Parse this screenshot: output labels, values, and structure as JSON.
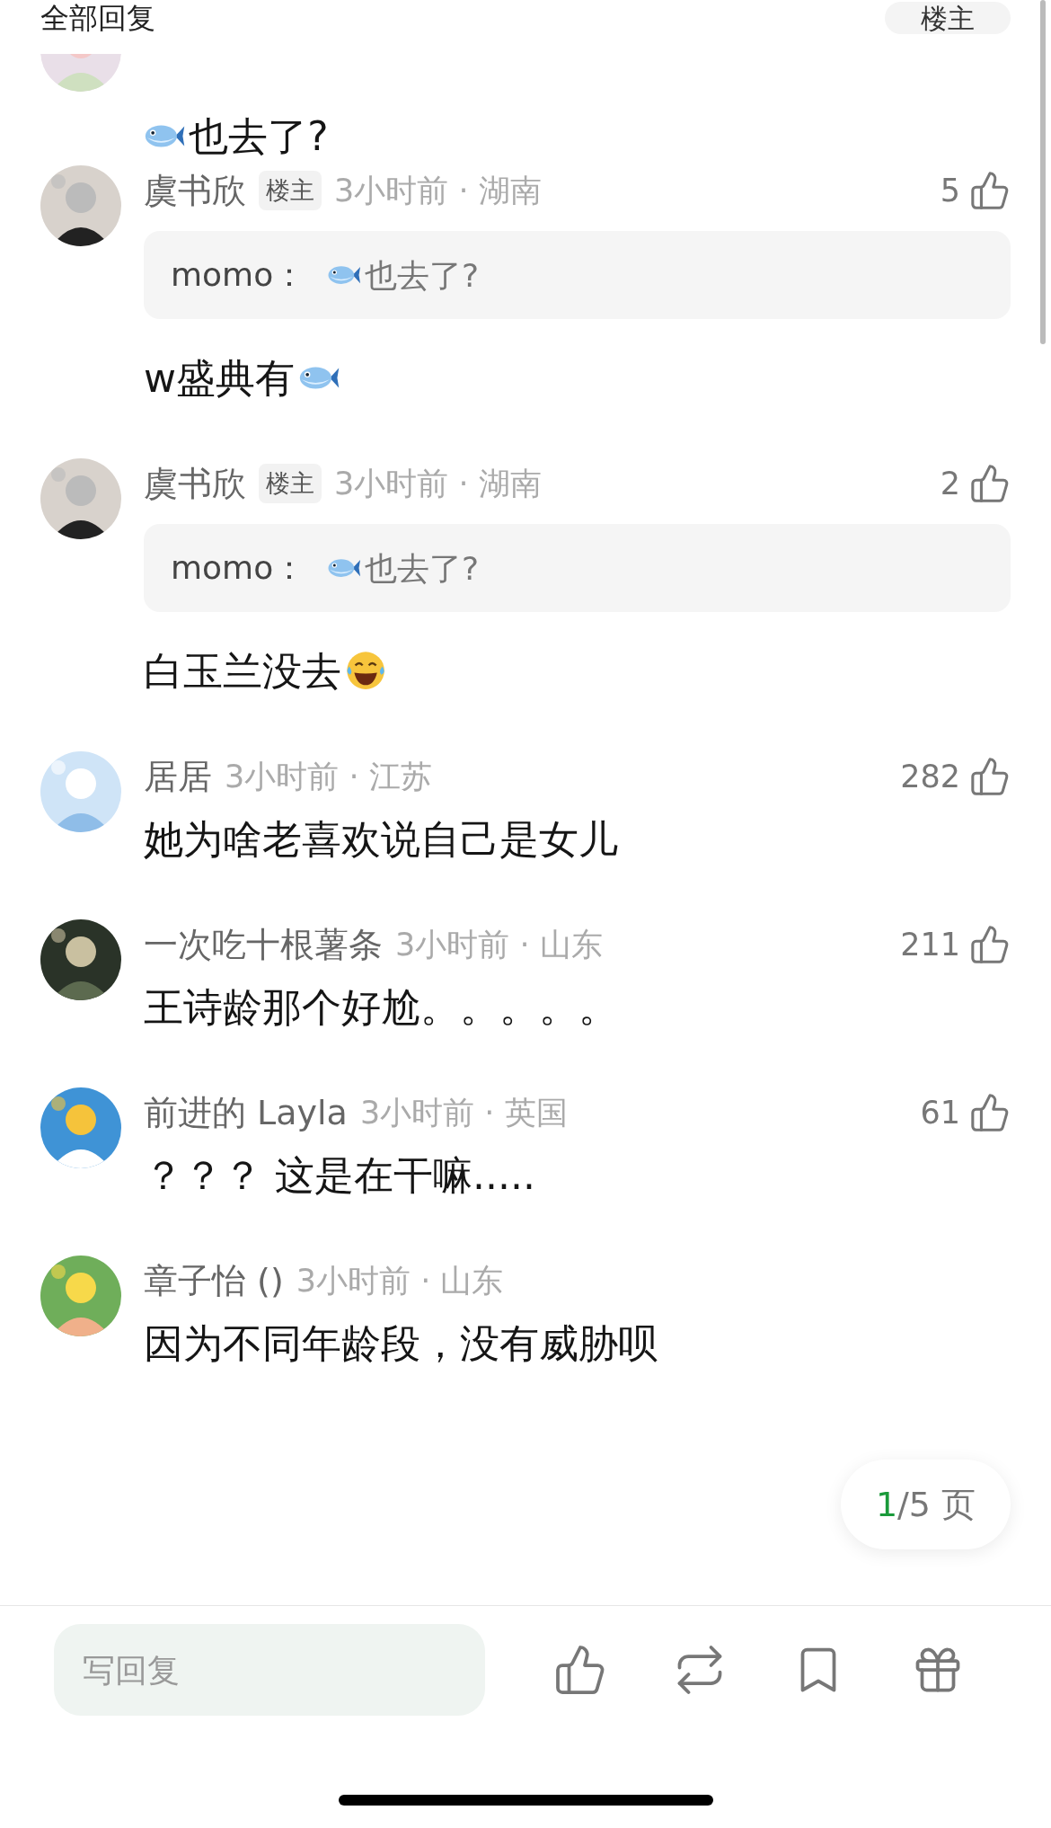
{
  "header": {
    "title": "全部回复",
    "filter_button": "楼主"
  },
  "comments": [
    {
      "kind": "partial",
      "body": [
        {
          "kind": "fish"
        },
        {
          "kind": "text",
          "text": "也去了?"
        }
      ]
    },
    {
      "kind": "full",
      "author": "虞书欣",
      "badge": "楼主",
      "meta": "3小时前 · 湖南",
      "likes": "5",
      "quote": {
        "author": "momo：",
        "body": [
          {
            "kind": "fish"
          },
          {
            "kind": "text",
            "text": "也去了?"
          }
        ]
      },
      "body": [
        {
          "kind": "text",
          "text": "w盛典有"
        },
        {
          "kind": "fish"
        }
      ]
    },
    {
      "kind": "full",
      "author": "虞书欣",
      "badge": "楼主",
      "meta": "3小时前 · 湖南",
      "likes": "2",
      "quote": {
        "author": "momo：",
        "body": [
          {
            "kind": "fish"
          },
          {
            "kind": "text",
            "text": "也去了?"
          }
        ]
      },
      "body": [
        {
          "kind": "text",
          "text": "白玉兰没去"
        },
        {
          "kind": "laugh"
        }
      ]
    },
    {
      "kind": "full",
      "author": "居居",
      "meta": "3小时前 · 江苏",
      "likes": "282",
      "body": [
        {
          "kind": "text",
          "text": "她为啥老喜欢说自己是女儿"
        }
      ]
    },
    {
      "kind": "full",
      "author": "一次吃十根薯条",
      "meta": "3小时前 · 山东",
      "likes": "211",
      "body": [
        {
          "kind": "text",
          "text": "王诗龄那个好尬。。。。。"
        }
      ]
    },
    {
      "kind": "full",
      "author": "前进的 Layla",
      "meta": "3小时前 · 英国",
      "likes": "61",
      "body": [
        {
          "kind": "text",
          "text": "？？？ 这是在干嘛....."
        }
      ]
    },
    {
      "kind": "full",
      "author": "章子怡 ()",
      "meta": "3小时前 · 山东",
      "body": [
        {
          "kind": "text",
          "text": "因为不同年龄段，没有威胁呗"
        }
      ]
    }
  ],
  "pager": {
    "current": "1",
    "rest": "/5 页"
  },
  "reply_bar": {
    "placeholder": "写回复"
  }
}
